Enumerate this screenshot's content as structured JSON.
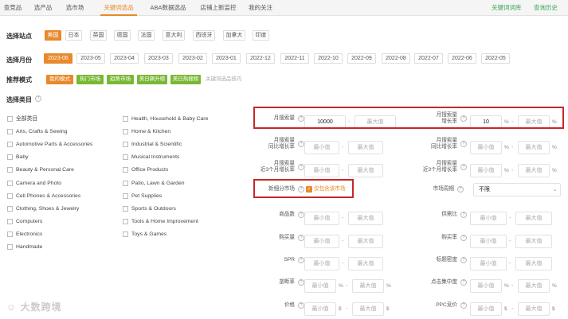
{
  "nav": {
    "tabs": [
      "查竞品",
      "选产品",
      "选市场",
      "关键词选品",
      "ABA数据选品",
      "店铺上新监控",
      "我的关注"
    ],
    "active_tab": "关键词选品",
    "right_links": [
      "关键词词库",
      "查询历史"
    ]
  },
  "site": {
    "label": "选择站点",
    "options": [
      "美国",
      "日本",
      "英国",
      "德国",
      "法国",
      "意大利",
      "西班牙",
      "加拿大",
      "印度"
    ],
    "selected": "美国"
  },
  "month": {
    "label": "选择月份",
    "options": [
      "2023-06",
      "2023-05",
      "2023-04",
      "2023-03",
      "2023-02",
      "2023-01",
      "2022-12",
      "2022-11",
      "2022-10",
      "2022-09",
      "2022-08",
      "2022-07",
      "2022-06",
      "2022-05"
    ],
    "selected": "2023-06"
  },
  "mode": {
    "label": "推荐模式",
    "options": [
      "我的模式",
      "热门市场",
      "趋势市场",
      "美日飙升榜",
      "美日热搜榜"
    ],
    "tips_link": "关键词选品技巧"
  },
  "category": {
    "label": "选择类目",
    "col1": [
      "全部类目",
      "Arts, Crafts & Sewing",
      "Automotive Parts & Accessories",
      "Baby",
      "Beauty & Personal Care",
      "Camera and Photo",
      "Cell Phones & Accessories",
      "Clothing, Shoes & Jewelry",
      "Computers",
      "Electronics",
      "Handmade"
    ],
    "col2": [
      "Health, Household & Baby Care",
      "Home & Kitchen",
      "Industrial & Scientific",
      "Musical Instruments",
      "Office Products",
      "Patio, Lawn & Garden",
      "Pet Supplies",
      "Sports & Outdoors",
      "Tools & Home Improvement",
      "Toys & Games"
    ]
  },
  "filters": {
    "min_ph": "最小值",
    "max_ph": "最大值",
    "dash": "-",
    "pct": "%",
    "dollar": "$",
    "help": "?",
    "f1": {
      "label": "月搜索量",
      "min": "10000"
    },
    "f2": {
      "label": "月搜索量\n增长率",
      "min": "10"
    },
    "f3": {
      "label": "月搜索量\n同比增长率"
    },
    "f4": {
      "label": "月搜索量\n同比增长率"
    },
    "f5": {
      "label": "月搜索量\n近3个月增长率"
    },
    "f6": {
      "label": "月搜索量\n近3个月增长率"
    },
    "new_market": {
      "label": "新细分市场",
      "checkbox": "仅包含该市场"
    },
    "market_cycle": {
      "label": "市场周期",
      "value": "不限"
    },
    "f7": {
      "label": "商品数"
    },
    "f8": {
      "label": "供需比"
    },
    "f9": {
      "label": "购买量"
    },
    "f10": {
      "label": "购买率"
    },
    "f11": {
      "label": "SPR"
    },
    "f12": {
      "label": "标题密度"
    },
    "f13": {
      "label": "垄断率"
    },
    "f14": {
      "label": "点击集中度"
    },
    "f15": {
      "label": "价格"
    },
    "f16": {
      "label": "PPC竞价"
    }
  },
  "colors": {
    "accent": "#e8892b",
    "mode": "#7ab834",
    "green": "#3aa352",
    "red": "#c62828"
  },
  "watermark": "大数跨境"
}
